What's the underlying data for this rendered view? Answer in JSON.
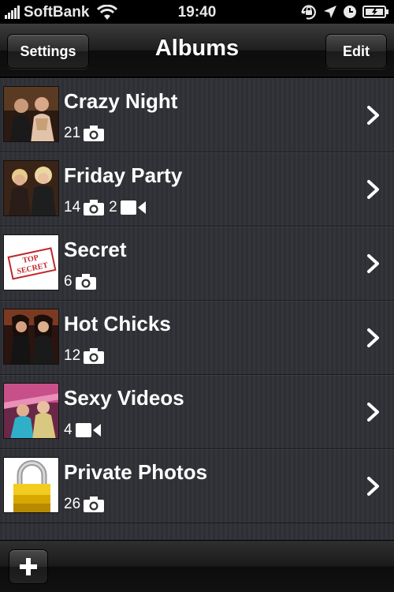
{
  "status_bar": {
    "carrier": "SoftBank",
    "time": "19:40",
    "icons": [
      "signal-bars-icon",
      "wifi-icon",
      "orientation-lock-icon",
      "location-arrow-icon",
      "alarm-clock-icon",
      "battery-icon"
    ]
  },
  "nav": {
    "title": "Albums",
    "left_button": "Settings",
    "right_button": "Edit"
  },
  "albums": [
    {
      "title": "Crazy Night",
      "photo_count": "21",
      "video_count": "",
      "thumb": "party-photo"
    },
    {
      "title": "Friday Party",
      "photo_count": "14",
      "video_count": "2",
      "thumb": "party-photo"
    },
    {
      "title": "Secret",
      "photo_count": "6",
      "video_count": "",
      "thumb": "top-secret-stamp",
      "stamp_text": "TOP SECRET"
    },
    {
      "title": "Hot Chicks",
      "photo_count": "12",
      "video_count": "",
      "thumb": "party-photo"
    },
    {
      "title": "Sexy Videos",
      "photo_count": "",
      "video_count": "4",
      "thumb": "party-photo"
    },
    {
      "title": "Private Photos",
      "photo_count": "26",
      "video_count": "",
      "thumb": "padlock-icon"
    }
  ],
  "toolbar": {
    "add_icon": "plus-icon"
  },
  "colors": {
    "bar_black": "#111111",
    "list_bg": "#313237",
    "text": "#ffffff"
  }
}
